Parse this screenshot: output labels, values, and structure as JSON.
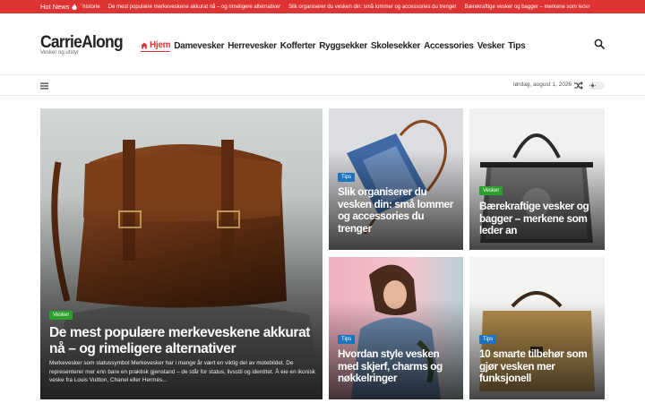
{
  "ticker": {
    "label": "Hot News",
    "items": [
      "’ historie",
      "De mest populære merkeveskene akkurat nå – og rimeligere alternativer",
      "Slik organiserer du vesken din: små lommer og accessories du trenger",
      "Bærekraftige vesker og bagger – merkene som leder"
    ]
  },
  "header": {
    "logo": "CarrieAlong",
    "tagline": "Vesker og utstyr",
    "nav": [
      {
        "label": "Hjem",
        "active": true
      },
      {
        "label": "Damevesker"
      },
      {
        "label": "Herrevesker"
      },
      {
        "label": "Kofferter"
      },
      {
        "label": "Ryggsekker"
      },
      {
        "label": "Skolesekker"
      },
      {
        "label": "Accessories"
      },
      {
        "label": "Vesker"
      },
      {
        "label": "Tips"
      }
    ]
  },
  "subbar": {
    "date": "lørdag, august 1, 2026"
  },
  "cards": {
    "main": {
      "category": "Vesker",
      "title": "De mest populære merkeveskene akkurat nå – og rimeligere alternativer",
      "excerpt": "Merkevesker som statussymbol Merkevesker har i mange år vært en viktig del av motebildet. De representerer mer enn bare en praktisk gjenstand – de står for status, livsstil og identitet. Å eie en ikonisk veske fra Louis Vuitton, Chanel eller Hermès..."
    },
    "tips1": {
      "category": "Tips",
      "title": "Slik organiserer du vesken din: små lommer og accessories du trenger"
    },
    "vesker1": {
      "category": "Vesker",
      "title": "Bærekraftige vesker og bagger – merkene som leder an"
    },
    "tips2": {
      "category": "Tips",
      "title": "Hvordan style vesken med skjerf, charms og nøkkelringer"
    },
    "tips3": {
      "category": "Tips",
      "title": "10 smarte tilbehør som gjør vesken mer funksjonell"
    }
  },
  "colors": {
    "accent": "#dd3333",
    "badge_green": "#2ca02c",
    "badge_blue": "#1e73be"
  },
  "icons": [
    "flame-icon",
    "home-icon",
    "search-icon",
    "menu-icon",
    "shuffle-icon",
    "sun-icon"
  ]
}
